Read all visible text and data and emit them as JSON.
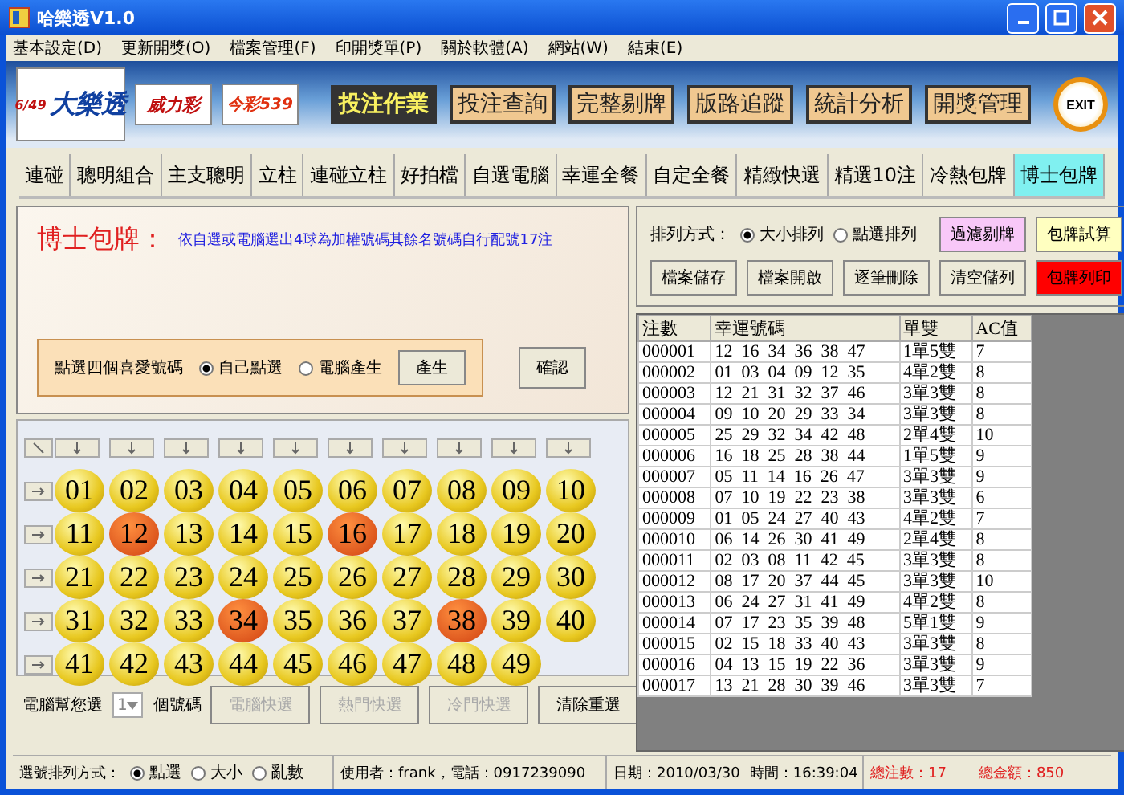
{
  "window": {
    "title": "哈樂透V1.0"
  },
  "menu": [
    "基本設定(D)",
    "更新開獎(O)",
    "檔案管理(F)",
    "印開獎單(P)",
    "關於軟體(A)",
    "網站(W)",
    "結束(E)"
  ],
  "logos": [
    {
      "kind": "lotto",
      "name": "大樂透",
      "sub": "6/49"
    },
    {
      "kind": "power",
      "name": "威力彩"
    },
    {
      "kind": "daily",
      "name": "今彩539"
    }
  ],
  "main_buttons": [
    {
      "label": "投注作業",
      "selected": true
    },
    {
      "label": "投注查詢",
      "selected": false
    },
    {
      "label": "完整剔牌",
      "selected": false
    },
    {
      "label": "版路追蹤",
      "selected": false
    },
    {
      "label": "統計分析",
      "selected": false
    },
    {
      "label": "開獎管理",
      "selected": false
    }
  ],
  "exit_button": "EXIT",
  "tabs": [
    {
      "label": "連碰",
      "selected": false
    },
    {
      "label": "聰明組合",
      "selected": false
    },
    {
      "label": "主支聰明",
      "selected": false
    },
    {
      "label": "立柱",
      "selected": false
    },
    {
      "label": "連碰立柱",
      "selected": false
    },
    {
      "label": "好拍檔",
      "selected": false
    },
    {
      "label": "自選電腦",
      "selected": false
    },
    {
      "label": "幸運全餐",
      "selected": false
    },
    {
      "label": "自定全餐",
      "selected": false
    },
    {
      "label": "精緻快選",
      "selected": false
    },
    {
      "label": "精選10注",
      "selected": false
    },
    {
      "label": "冷熱包牌",
      "selected": false
    },
    {
      "label": "博士包牌",
      "selected": true
    }
  ],
  "intro": {
    "title": "博士包牌：",
    "description": "依自選或電腦選出4球為加權號碼其餘名號碼自行配號17注"
  },
  "pick_box": {
    "label": "點選四個喜愛號碼",
    "options": [
      {
        "label": "自己點選",
        "selected": true
      },
      {
        "label": "電腦產生",
        "selected": false
      }
    ],
    "button": "產生"
  },
  "confirm_button": "確認",
  "balls": [
    {
      "number": "01",
      "selected": false
    },
    {
      "number": "02",
      "selected": false
    },
    {
      "number": "03",
      "selected": false
    },
    {
      "number": "04",
      "selected": false
    },
    {
      "number": "05",
      "selected": false
    },
    {
      "number": "06",
      "selected": false
    },
    {
      "number": "07",
      "selected": false
    },
    {
      "number": "08",
      "selected": false
    },
    {
      "number": "09",
      "selected": false
    },
    {
      "number": "10",
      "selected": false
    },
    {
      "number": "11",
      "selected": false
    },
    {
      "number": "12",
      "selected": true
    },
    {
      "number": "13",
      "selected": false
    },
    {
      "number": "14",
      "selected": false
    },
    {
      "number": "15",
      "selected": false
    },
    {
      "number": "16",
      "selected": true
    },
    {
      "number": "17",
      "selected": false
    },
    {
      "number": "18",
      "selected": false
    },
    {
      "number": "19",
      "selected": false
    },
    {
      "number": "20",
      "selected": false
    },
    {
      "number": "21",
      "selected": false
    },
    {
      "number": "22",
      "selected": false
    },
    {
      "number": "23",
      "selected": false
    },
    {
      "number": "24",
      "selected": false
    },
    {
      "number": "25",
      "selected": false
    },
    {
      "number": "26",
      "selected": false
    },
    {
      "number": "27",
      "selected": false
    },
    {
      "number": "28",
      "selected": false
    },
    {
      "number": "29",
      "selected": false
    },
    {
      "number": "30",
      "selected": false
    },
    {
      "number": "31",
      "selected": false
    },
    {
      "number": "32",
      "selected": false
    },
    {
      "number": "33",
      "selected": false
    },
    {
      "number": "34",
      "selected": true
    },
    {
      "number": "35",
      "selected": false
    },
    {
      "number": "36",
      "selected": false
    },
    {
      "number": "37",
      "selected": false
    },
    {
      "number": "38",
      "selected": true
    },
    {
      "number": "39",
      "selected": false
    },
    {
      "number": "40",
      "selected": false
    },
    {
      "number": "41",
      "selected": false
    },
    {
      "number": "42",
      "selected": false
    },
    {
      "number": "43",
      "selected": false
    },
    {
      "number": "44",
      "selected": false
    },
    {
      "number": "45",
      "selected": false
    },
    {
      "number": "46",
      "selected": false
    },
    {
      "number": "47",
      "selected": false
    },
    {
      "number": "48",
      "selected": false
    },
    {
      "number": "49",
      "selected": false
    }
  ],
  "quick_pick": {
    "label": "電腦幫您選",
    "value": "1",
    "unit": "個號碼",
    "buttons": [
      {
        "label": "電腦快選",
        "disabled": true
      },
      {
        "label": "熱門快選",
        "disabled": true
      },
      {
        "label": "冷門快選",
        "disabled": true
      },
      {
        "label": "清除重選",
        "disabled": false
      }
    ]
  },
  "sort": {
    "label": "排列方式：",
    "options": [
      {
        "label": "大小排列",
        "selected": true
      },
      {
        "label": "點選排列",
        "selected": false
      }
    ]
  },
  "action_buttons": [
    {
      "label": "過濾剔牌",
      "color": "#f8c8f8"
    },
    {
      "label": "包牌試算",
      "color": "#ffffc0"
    },
    {
      "label": "檔案儲存",
      "color": "#ece9d8"
    },
    {
      "label": "檔案開啟",
      "color": "#ece9d8"
    },
    {
      "label": "逐筆刪除",
      "color": "#ece9d8"
    },
    {
      "label": "清空儲列",
      "color": "#ece9d8"
    },
    {
      "label": "包牌列印",
      "color": "#ff0000"
    }
  ],
  "table": {
    "columns": [
      "注數",
      "幸運號碼",
      "單雙",
      "AC值"
    ],
    "rows": [
      [
        "000001",
        "12  16  34  36  38  47",
        "1單5雙",
        "7"
      ],
      [
        "000002",
        "01  03  04  09  12  35",
        "4單2雙",
        "8"
      ],
      [
        "000003",
        "12  21  31  32  37  46",
        "3單3雙",
        "8"
      ],
      [
        "000004",
        "09  10  20  29  33  34",
        "3單3雙",
        "8"
      ],
      [
        "000005",
        "25  29  32  34  42  48",
        "2單4雙",
        "10"
      ],
      [
        "000006",
        "16  18  25  28  38  44",
        "1單5雙",
        "9"
      ],
      [
        "000007",
        "05  11  14  16  26  47",
        "3單3雙",
        "9"
      ],
      [
        "000008",
        "07  10  19  22  23  38",
        "3單3雙",
        "6"
      ],
      [
        "000009",
        "01  05  24  27  40  43",
        "4單2雙",
        "7"
      ],
      [
        "000010",
        "06  14  26  30  41  49",
        "2單4雙",
        "8"
      ],
      [
        "000011",
        "02  03  08  11  42  45",
        "3單3雙",
        "8"
      ],
      [
        "000012",
        "08  17  20  37  44  45",
        "3單3雙",
        "10"
      ],
      [
        "000013",
        "06  24  27  31  41  49",
        "4單2雙",
        "8"
      ],
      [
        "000014",
        "07  17  23  35  39  48",
        "5單1雙",
        "9"
      ],
      [
        "000015",
        "02  15  18  33  40  43",
        "3單3雙",
        "8"
      ],
      [
        "000016",
        "04  13  15  19  22  36",
        "3單3雙",
        "9"
      ],
      [
        "000017",
        "13  21  28  30  39  46",
        "3單3雙",
        "7"
      ]
    ]
  },
  "status_bar": {
    "sort_label": "選號排列方式：",
    "sort_options": [
      {
        "label": "點選",
        "selected": true
      },
      {
        "label": "大小",
        "selected": false
      },
      {
        "label": "亂數",
        "selected": false
      }
    ],
    "user": "使用者：frank，電話：0917239090",
    "date": "日期：2010/03/30",
    "time": "時間：16:39:04",
    "total_count": "總注數：17",
    "total_amount": "總金額：850"
  }
}
